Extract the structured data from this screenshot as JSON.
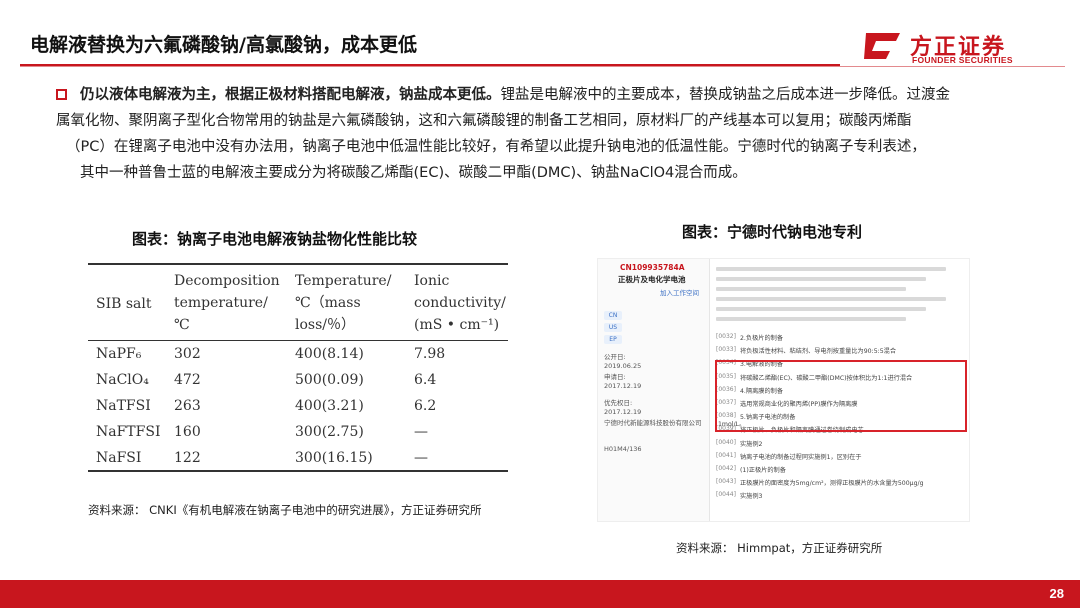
{
  "header": {
    "title": "电解液替换为六氟磷酸钠/高氯酸钠，成本更低",
    "logo_cn": "方正证券",
    "logo_en": "FOUNDER SECURITIES"
  },
  "body": {
    "bold_lead": "仍以液体电解液为主，根据正极材料搭配电解液，钠盐成本更低。",
    "line1_rest": "锂盐是电解液中的主要成本，替换成钠盐之后成本进一步降低。过渡金",
    "line2": "属氧化物、聚阴离子型化合物常用的钠盐是六氟磷酸钠，这和六氟磷酸锂的制备工艺相同，原材料厂的产线基本可以复用；碳酸丙烯酯",
    "line3": "（PC）在锂离子电池中没有办法用，钠离子电池中低温性能比较好，有希望以此提升钠电池的低温性能。宁德时代的钠离子专利表述，",
    "line4": "其中一种普鲁士蓝的电解液主要成分为将碳酸乙烯酯(EC)、碳酸二甲酯(DMC)、钠盐NaClO4混合而成。"
  },
  "left_figure": {
    "caption": "图表：钠离子电池电解液钠盐物化性能比较",
    "headers": {
      "c1": "SIB salt",
      "c2": [
        "Decomposition",
        "temperature/",
        "℃"
      ],
      "c3": [
        "Temperature/",
        "℃（mass",
        "loss/％）"
      ],
      "c4": [
        "Ionic",
        "conductivity/",
        "(mS • cm⁻¹)"
      ]
    },
    "rows": [
      {
        "salt": "NaPF₆",
        "decomp": "302",
        "temp": "400(8.14)",
        "cond": "7.98"
      },
      {
        "salt": "NaClO₄",
        "decomp": "472",
        "temp": "500(0.09)",
        "cond": "6.4"
      },
      {
        "salt": "NaTFSI",
        "decomp": "263",
        "temp": "400(3.21)",
        "cond": "6.2"
      },
      {
        "salt": "NaFTFSI",
        "decomp": "160",
        "temp": "300(2.75)",
        "cond": "—"
      },
      {
        "salt": "NaFSI",
        "decomp": "122",
        "temp": "300(16.15)",
        "cond": "—"
      }
    ],
    "source": "资料来源：  CNKI《有机电解液在钠离子电池中的研究进展》，方正证券研究所"
  },
  "right_figure": {
    "caption": "图表：宁德时代钠电池专利",
    "patent_id": "CN109935784A",
    "patent_title": "正极片及电化学电池",
    "tags": [
      "CN",
      "US",
      "EP"
    ],
    "pub_label": "公开日:",
    "pub_date": "2019.06.25",
    "app_label": "申请日:",
    "app_date": "2017.12.19",
    "prio_label": "优先权日:",
    "prio_date": "2017.12.19",
    "applicant": "宁德时代新能源科技股份有限公司",
    "ipc": "H01M4/136",
    "follow": "加入工作空间",
    "entries": [
      {
        "num": "[0032]",
        "text": "2.负极片的制备"
      },
      {
        "num": "[0033]",
        "text": "将负极活性材料、粘结剂、导电剂按重量比为90:5:5混合"
      },
      {
        "num": "[0034]",
        "text": "3.电解液的制备"
      },
      {
        "num": "[0035]",
        "text": "将碳酸乙烯酯(EC)、碳酸二甲酯(DMC)按体积比为1:1进行混合"
      },
      {
        "num": "[0036]",
        "text": "4.隔离膜的制备"
      },
      {
        "num": "[0037]",
        "text": "选用常规商业化的聚丙烯(PP)膜作为隔离膜"
      },
      {
        "num": "[0038]",
        "text": "5.钠离子电池的制备"
      },
      {
        "num": "[0039]",
        "text": "将正极片、负极片和隔离膜通过卷绕制成电芯"
      },
      {
        "num": "[0040]",
        "text": "实施例2"
      },
      {
        "num": "[0041]",
        "text": "钠离子电池的制备过程同实施例1，区别在于"
      },
      {
        "num": "[0042]",
        "text": "(1)正极片的制备"
      },
      {
        "num": "[0043]",
        "text": "正极膜片的面密度为5mg/cm²，测得正极膜片的水含量为500μg/g"
      },
      {
        "num": "[0044]",
        "text": "实施例3"
      }
    ],
    "highlight_text": "1mol/L。",
    "source": "资料来源：  Himmpat，方正证券研究所"
  },
  "footer": {
    "page": "28"
  },
  "colors": {
    "brand_red": "#c8161e"
  }
}
